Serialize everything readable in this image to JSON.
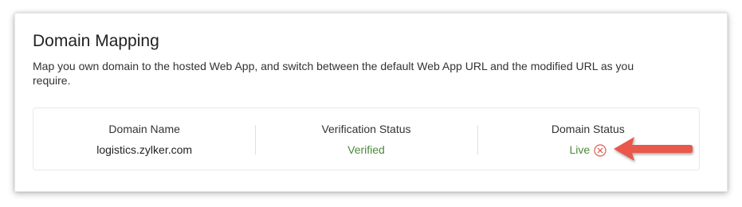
{
  "domain_mapping": {
    "title": "Domain Mapping",
    "description": "Map you own domain to the hosted Web App, and switch between the default Web App URL and the modified URL as you require.",
    "columns": {
      "domain_name": {
        "header": "Domain Name",
        "value": "logistics.zylker.com"
      },
      "verification_status": {
        "header": "Verification Status",
        "value": "Verified"
      },
      "domain_status": {
        "header": "Domain Status",
        "value": "Live"
      }
    }
  },
  "colors": {
    "status_green": "#4c8a3c",
    "remove_icon_red": "#e05a4f",
    "annotation_arrow": "#e8584b"
  },
  "icons": {
    "remove": "close-circle-icon",
    "annotation": "arrow-left-annotation"
  }
}
